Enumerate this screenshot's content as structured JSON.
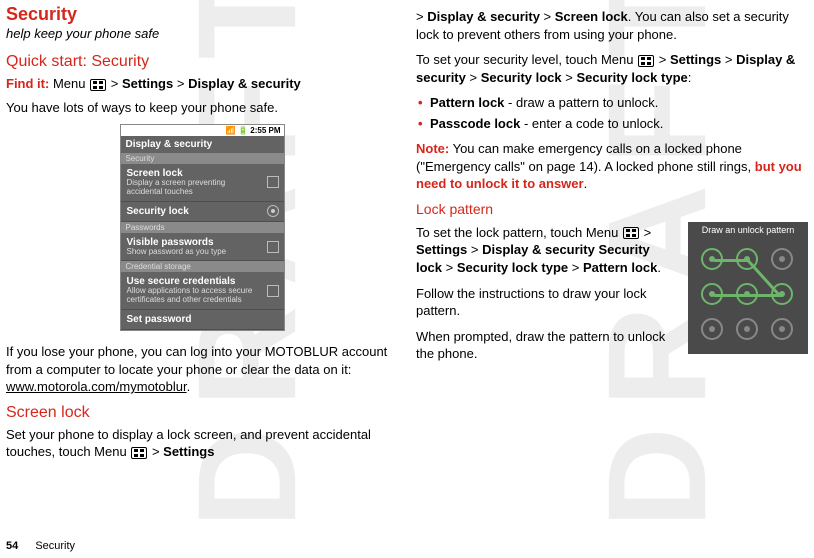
{
  "watermark": "DRAFT",
  "left": {
    "title": "Security",
    "tagline": "help keep your phone safe",
    "quick_start_heading": "Quick start: Security",
    "find_it_label": "Find it:",
    "find_it_pre": "Menu",
    "find_it_path1": "Settings",
    "find_it_path2": "Display & security",
    "intro": "You have lots of ways to keep your phone safe.",
    "phone": {
      "time": "2:55 PM",
      "header": "Display & security",
      "sec_security": "Security",
      "screen_lock_title": "Screen lock",
      "screen_lock_sub": "Display a screen preventing accidental touches",
      "security_lock_title": "Security lock",
      "sec_passwords": "Passwords",
      "visible_pw_title": "Visible passwords",
      "visible_pw_sub": "Show password as you type",
      "sec_cred": "Credential storage",
      "use_secure_title": "Use secure credentials",
      "use_secure_sub": "Allow applications to access secure certificates and other credentials",
      "set_password_title": "Set password"
    },
    "lost_phone": "If you lose your phone, you can log into your MOTOBLUR account from a computer to locate your phone or clear the data on it:",
    "mymotoblur": "www.motorola.com/mymotoblur",
    "screen_lock_heading": "Screen lock",
    "screen_lock_p1a": "Set your phone to display a lock screen, and prevent accidental touches, touch Menu",
    "screen_lock_p1b": "Settings"
  },
  "right": {
    "cont_a": "Display & security",
    "cont_b": "Screen lock",
    "cont_c": ". You can also set a security lock to prevent others from using your phone.",
    "set_level_a": "To set your security level, touch Menu",
    "set_level_b": "Settings",
    "set_level_c": "Display & security",
    "set_level_d": "Security lock",
    "set_level_e": "Security lock type",
    "bullets": {
      "pattern_b": "Pattern lock",
      "pattern_t": " - draw a pattern to unlock.",
      "pass_b": "Passcode lock",
      "pass_t": " - enter a code to unlock."
    },
    "note_label": "Note:",
    "note_a": " You can make emergency calls on a locked phone (\"Emergency calls\" on page 14). A locked phone still rings, ",
    "note_unlock": "but you need to unlock it to answer",
    "lock_pattern_heading": "Lock pattern",
    "lp_a": "To set the lock pattern, touch Menu",
    "lp_b": "Settings",
    "lp_c": "Display & security",
    "lp_d": "Security lock",
    "lp_e": "Security lock type",
    "lp_f": "Pattern lock",
    "lp_follow": "Follow the instructions to draw your lock pattern.",
    "lp_prompt": "When prompted, draw the pattern to unlock the phone.",
    "pattern_box_title": "Draw an unlock pattern"
  },
  "footer": {
    "page": "54",
    "section": "Security"
  }
}
